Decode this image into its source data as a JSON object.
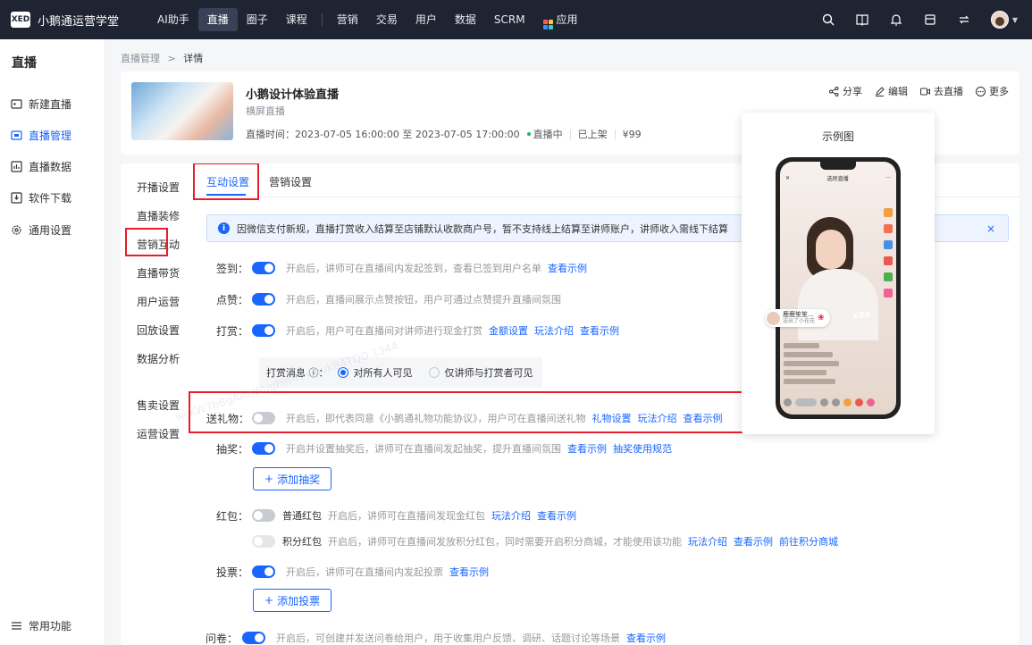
{
  "topbar": {
    "logo": "XED",
    "brand": "小鹅通运营学堂",
    "nav": [
      "AI助手",
      "直播",
      "圈子",
      "课程",
      "营销",
      "交易",
      "用户",
      "数据",
      "SCRM",
      "应用"
    ],
    "active_nav": "直播"
  },
  "sidebar": {
    "title": "直播",
    "items": [
      {
        "label": "新建直播",
        "icon": "new-live-icon"
      },
      {
        "label": "直播管理",
        "icon": "live-manage-icon"
      },
      {
        "label": "直播数据",
        "icon": "live-data-icon"
      },
      {
        "label": "软件下载",
        "icon": "download-icon"
      },
      {
        "label": "通用设置",
        "icon": "gear-icon"
      }
    ],
    "active": "直播管理",
    "bottom": "常用功能"
  },
  "breadcrumb": {
    "parent": "直播管理",
    "sep": ">",
    "current": "详情"
  },
  "live": {
    "title": "小鹅设计体验直播",
    "subtitle": "横屏直播",
    "time_label": "直播时间：",
    "time": "2023-07-05 16:00:00 至 2023-07-05 17:00:00",
    "status": "直播中",
    "shelf": "已上架",
    "price": "¥99",
    "actions": [
      "分享",
      "编辑",
      "去直播",
      "更多"
    ]
  },
  "left_nav": [
    "开播设置",
    "直播装修",
    "营销互动",
    "直播带货",
    "用户运营",
    "回放设置",
    "数据分析",
    "售卖设置",
    "运营设置"
  ],
  "left_nav_active": "营销互动",
  "tabs": [
    "互动设置",
    "营销设置"
  ],
  "active_tab": "互动设置",
  "alert": {
    "text": "因微信支付新规，直播打赏收入结算至店铺默认收款商户号，暂不支持线上结算至讲师账户，讲师收入需线下结算",
    "close": "×"
  },
  "settings": {
    "signin": {
      "label": "签到：",
      "on": true,
      "desc": "开启后，讲师可在直播间内发起签到，查看已签到用户名单",
      "links": [
        "查看示例"
      ]
    },
    "like": {
      "label": "点赞：",
      "on": true,
      "desc": "开启后，直播间展示点赞按钮，用户可通过点赞提升直播间氛围",
      "links": []
    },
    "reward": {
      "label": "打赏：",
      "on": true,
      "desc": "开启后，用户可在直播间对讲师进行现金打赏",
      "links": [
        "金额设置",
        "玩法介绍",
        "查看示例"
      ]
    },
    "reward_msg": {
      "label": "打赏消息",
      "info": "ⓘ",
      "colon": "：",
      "options": [
        "对所有人可见",
        "仅讲师与打赏者可见"
      ],
      "selected": "对所有人可见"
    },
    "gift": {
      "label": "送礼物：",
      "on": false,
      "desc": "开启后，即代表同意《小鹅通礼物功能协议》，用户可在直播间送礼物",
      "links": [
        "礼物设置",
        "玩法介绍",
        "查看示例"
      ]
    },
    "lottery": {
      "label": "抽奖：",
      "on": true,
      "desc": "开启并设置抽奖后，讲师可在直播间发起抽奖，提升直播间氛围",
      "links": [
        "查看示例",
        "抽奖使用规范"
      ],
      "button": "添加抽奖"
    },
    "redpacket": {
      "label": "红包：",
      "normal": {
        "name": "普通红包",
        "on": false,
        "desc": "开启后，讲师可在直播间发现金红包",
        "links": [
          "玩法介绍",
          "查看示例"
        ]
      },
      "points": {
        "name": "积分红包",
        "on": false,
        "disabled": true,
        "desc": "开启后，讲师可在直播间发放积分红包，同时需要开启积分商城，才能使用该功能",
        "links": [
          "玩法介绍",
          "查看示例",
          "前往积分商城"
        ]
      }
    },
    "vote": {
      "label": "投票：",
      "on": true,
      "desc": "开启后，讲师可在直播间内发起投票",
      "links": [
        "查看示例"
      ],
      "button": "添加投票"
    },
    "survey": {
      "label": "问卷：",
      "on": true,
      "desc": "开启后，可创建并发送问卷给用户，用于收集用户反馈、调研、话题讨论等场景",
      "links": [
        "查看示例"
      ]
    }
  },
  "preview": {
    "title": "示例图",
    "phone_title": "选房直播",
    "gift_user": "鹿鹿笙笙...",
    "gift_text": "送出了小花花",
    "gift_count": "x89"
  },
  "watermark": "wcKW7bBgAAhWugPin-TFwpukB4TQO 1344",
  "colors": {
    "accent": "#1966ff",
    "highlight": "#e61d2b",
    "topbar": "#1f2432"
  }
}
